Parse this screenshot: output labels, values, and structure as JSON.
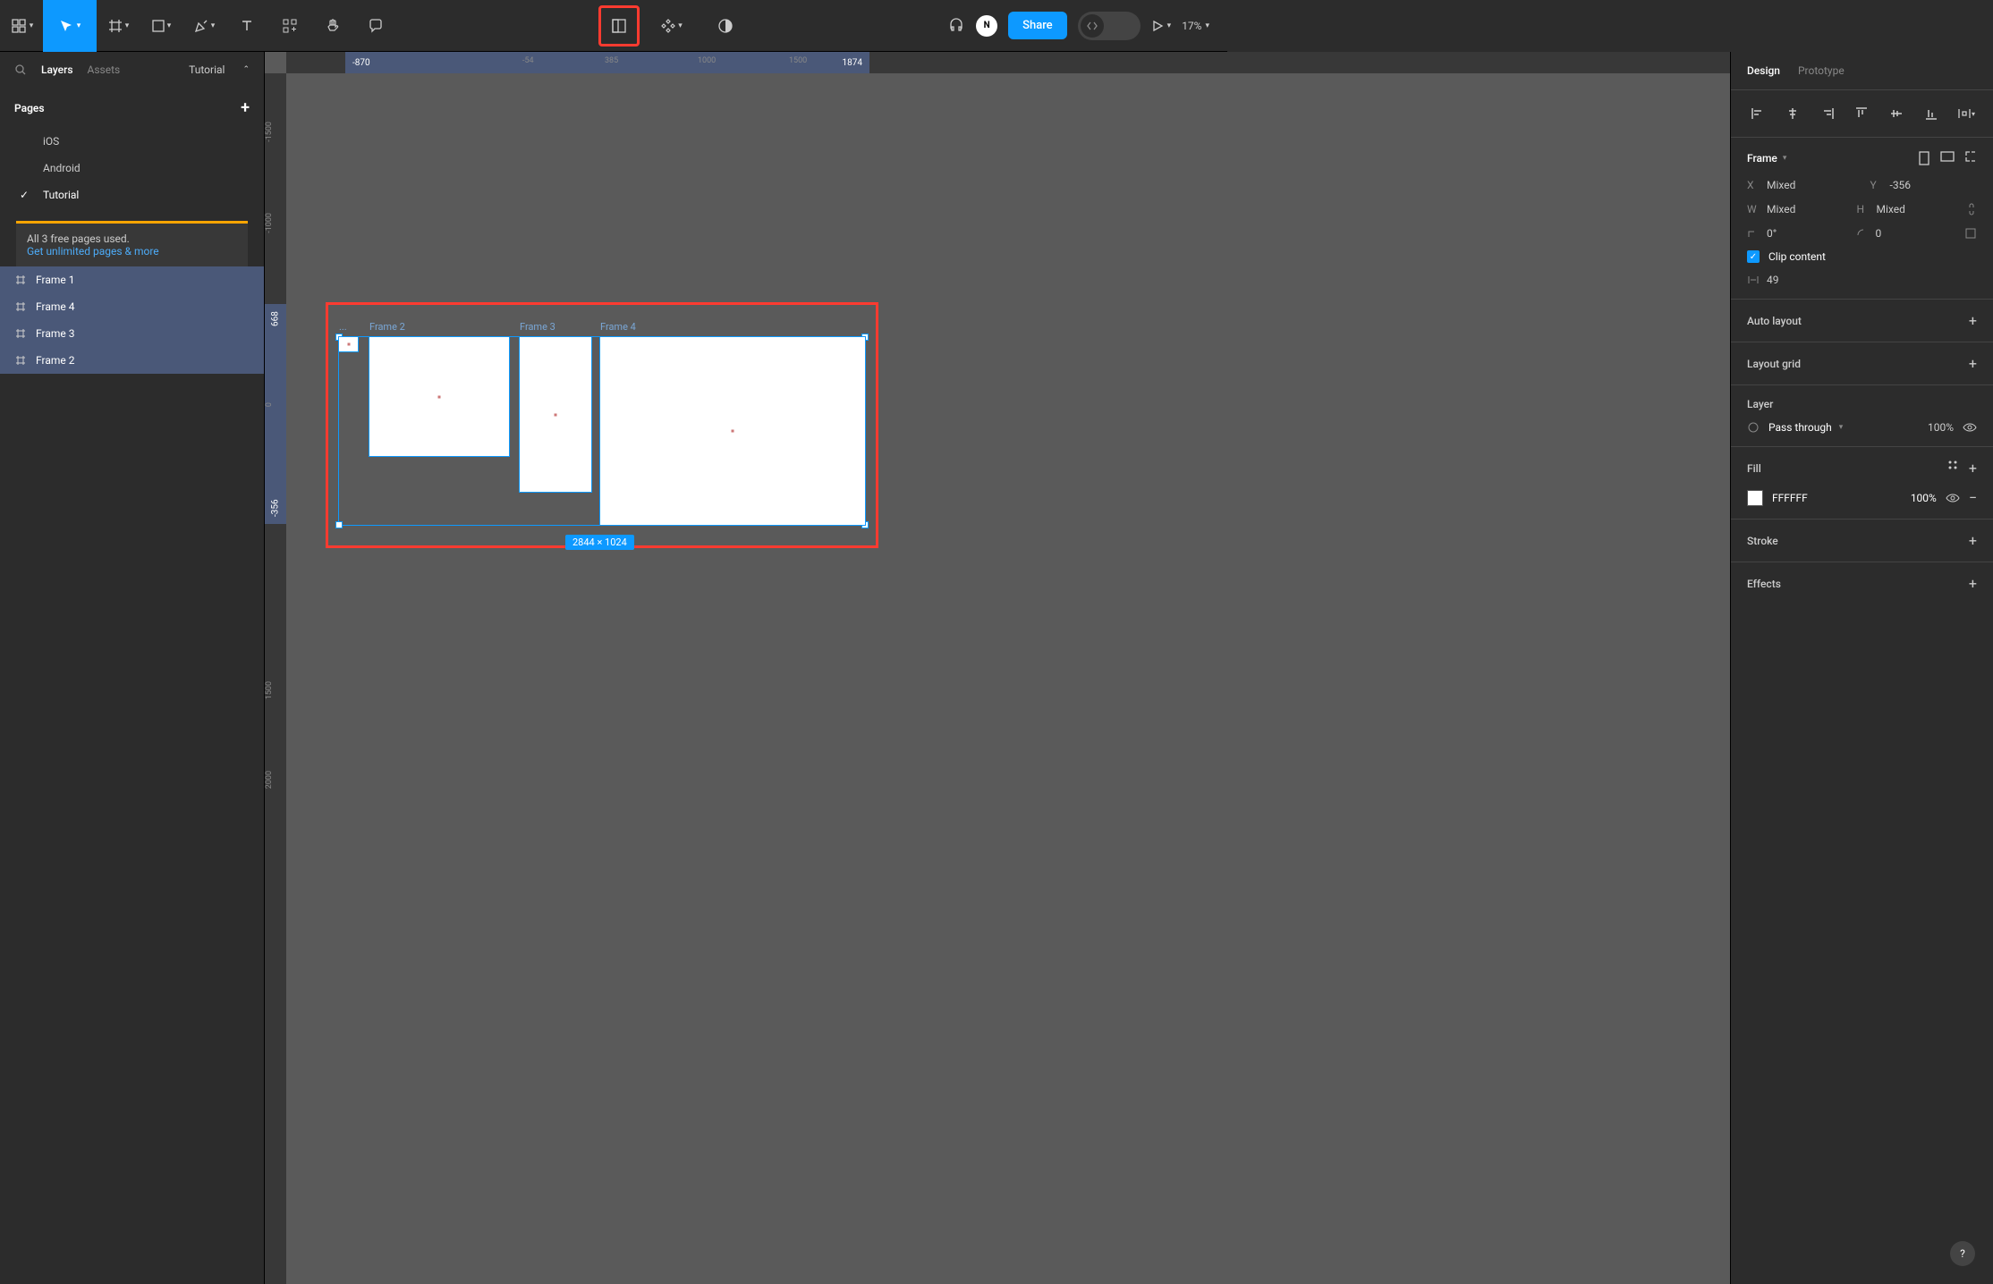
{
  "toolbar": {
    "zoom": "17%"
  },
  "share_label": "Share",
  "avatar_initial": "N",
  "left_panel": {
    "tabs": {
      "layers": "Layers",
      "assets": "Assets"
    },
    "file_name": "Tutorial",
    "pages_label": "Pages",
    "pages": [
      "iOS",
      "Android",
      "Tutorial"
    ],
    "upgrade": {
      "text": "All 3 free pages used.",
      "link": "Get unlimited pages & more"
    },
    "layers": [
      "Frame 1",
      "Frame 4",
      "Frame 3",
      "Frame 2"
    ]
  },
  "canvas": {
    "ruler_x": {
      "start": "-870",
      "end": "1874",
      "ticks": [
        "-54",
        "385",
        "1000",
        "1500"
      ]
    },
    "ruler_y": {
      "start": "-356",
      "end": "668",
      "ticks": [
        "-1500",
        "-1000",
        "0",
        "1500",
        "2000"
      ]
    },
    "frames": {
      "f1_label": "...",
      "f2_label": "Frame 2",
      "f3_label": "Frame 3",
      "f4_label": "Frame 4"
    },
    "selection_dim": "2844 × 1024"
  },
  "right_panel": {
    "tabs": {
      "design": "Design",
      "prototype": "Prototype"
    },
    "frame_label": "Frame",
    "x_label": "X",
    "x_value": "Mixed",
    "y_label": "Y",
    "y_value": "-356",
    "w_label": "W",
    "w_value": "Mixed",
    "h_label": "H",
    "h_value": "Mixed",
    "rotation": "0°",
    "corner": "0",
    "clip_label": "Clip content",
    "spacing": "49",
    "auto_layout": "Auto layout",
    "layout_grid": "Layout grid",
    "layer_label": "Layer",
    "blend_mode": "Pass through",
    "layer_opacity": "100%",
    "fill_label": "Fill",
    "fill_hex": "FFFFFF",
    "fill_opacity": "100%",
    "stroke_label": "Stroke",
    "effects_label": "Effects"
  }
}
